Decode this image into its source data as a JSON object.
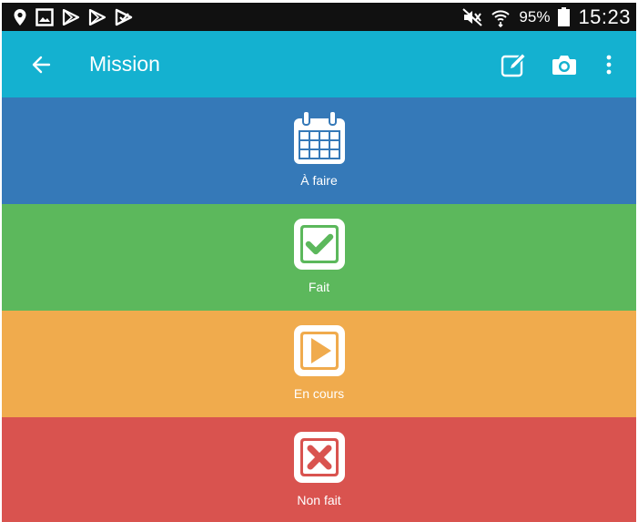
{
  "status_bar": {
    "battery": "95%",
    "time": "15:23",
    "left_icons": [
      "location-icon",
      "image-icon",
      "play-store-icon",
      "play-store-icon",
      "download-icon"
    ],
    "right_icons": [
      "mute-icon",
      "wifi-icon",
      "battery-icon"
    ]
  },
  "app_bar": {
    "title": "Mission",
    "background": "#14b1d0",
    "actions": [
      "edit-icon",
      "camera-icon",
      "more-vert-icon"
    ]
  },
  "tiles": [
    {
      "label": "À faire",
      "color": "#3579b8",
      "icon": "calendar-icon"
    },
    {
      "label": "Fait",
      "color": "#5cb85c",
      "icon": "checkbox-check-icon"
    },
    {
      "label": "En cours",
      "color": "#f0ab4d",
      "icon": "play-square-icon"
    },
    {
      "label": "Non fait",
      "color": "#d9534f",
      "icon": "close-square-icon"
    }
  ]
}
